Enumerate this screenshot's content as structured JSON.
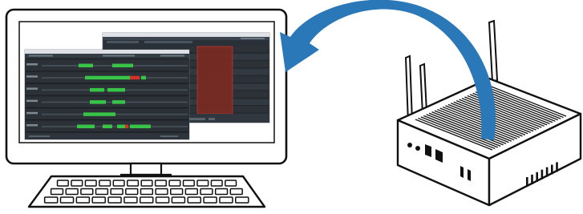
{
  "diagram": {
    "type": "illustration",
    "description_visible_text": "",
    "nodes": [
      {
        "id": "monitor",
        "role": "display"
      },
      {
        "id": "keyboard",
        "role": "input"
      },
      {
        "id": "device",
        "role": "mini-pc-with-antennas"
      }
    ],
    "edges": [
      {
        "from": "device",
        "to": "monitor",
        "style": "curved-arrow"
      }
    ]
  },
  "colors": {
    "outline": "#111111",
    "arrow": "#2b78b8",
    "screen_bg": "#23282e",
    "panel_bg": "#3a424a",
    "green": "#38c447",
    "red": "#d6302b",
    "dark_red": "#7a2a22"
  },
  "screen_back_window": {
    "tracks": 9
  },
  "screen_front_window": {
    "rows": 6
  },
  "icons": [
    "monitor-icon",
    "keyboard-icon",
    "mini-pc-icon",
    "arrow-icon"
  ]
}
